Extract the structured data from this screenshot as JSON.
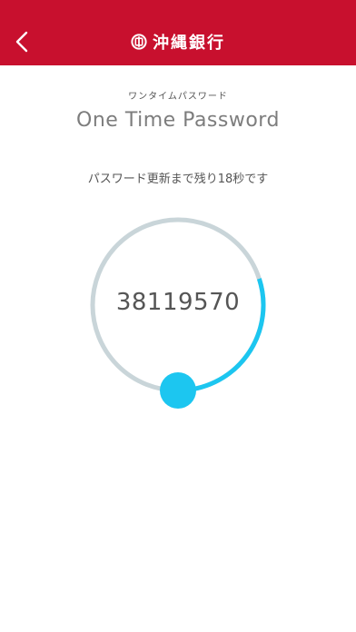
{
  "header": {
    "bank_name": "沖縄銀行",
    "back_icon": "chevron-left-icon",
    "logo_icon": "bank-logo-icon",
    "background_color": "#c8102e"
  },
  "main": {
    "subtitle_jp": "ワンタイムパスワード",
    "title_en": "One Time Password",
    "countdown_text": "パスワード更新まで残り18秒です",
    "otp_code": "38119570"
  },
  "timer": {
    "remaining_fraction": 0.3,
    "track_color": "#c9d5d9",
    "progress_color": "#1cc6f0"
  }
}
